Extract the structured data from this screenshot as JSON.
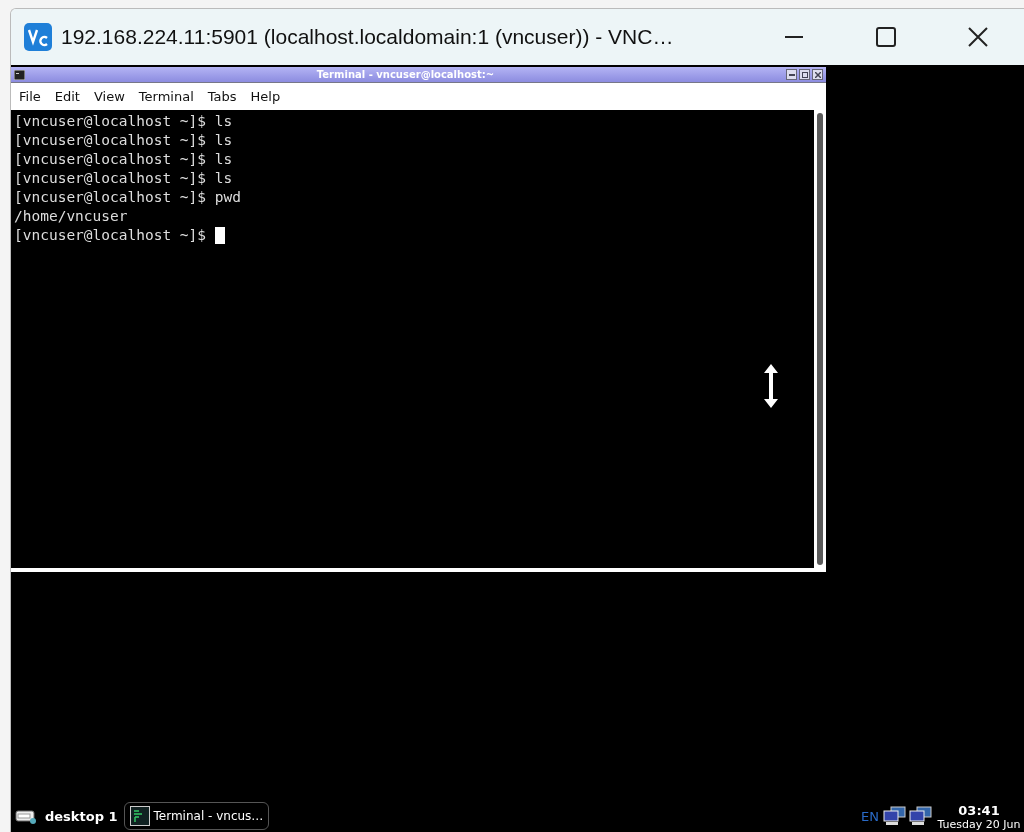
{
  "vnc_window": {
    "title": "192.168.224.11:5901 (localhost.localdomain:1 (vncuser)) - VNC…"
  },
  "terminal_window": {
    "title": "Terminal - vncuser@localhost:~",
    "menu": [
      "File",
      "Edit",
      "View",
      "Terminal",
      "Tabs",
      "Help"
    ],
    "lines": [
      "[vncuser@localhost ~]$ ls",
      "[vncuser@localhost ~]$ ls",
      "[vncuser@localhost ~]$ ls",
      "[vncuser@localhost ~]$ ls",
      "[vncuser@localhost ~]$ pwd",
      "/home/vncuser",
      "[vncuser@localhost ~]$ "
    ]
  },
  "taskbar": {
    "workspace": "desktop 1",
    "tasks": [
      {
        "label": "Terminal - vncus…",
        "selected": false
      }
    ],
    "language": "EN",
    "time": "03:41",
    "date": "Tuesday 20 Jun"
  }
}
